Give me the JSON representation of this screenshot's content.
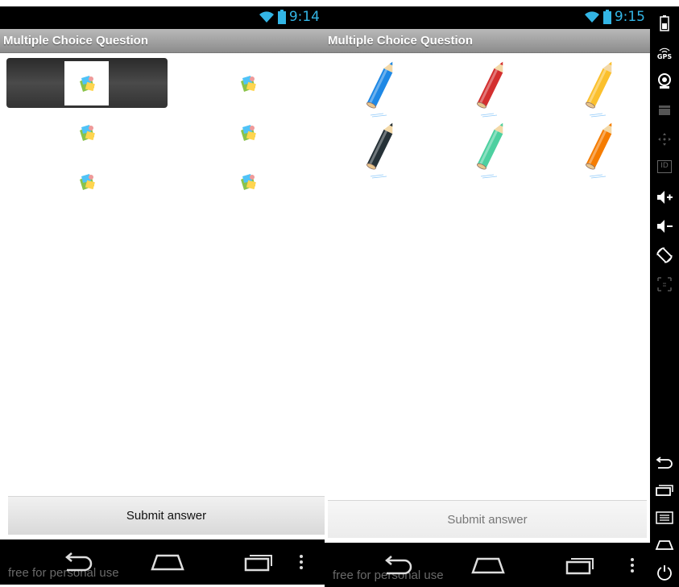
{
  "left_screen": {
    "status": {
      "time": "9:14"
    },
    "action_bar": {
      "title": "Multiple Choice Question"
    },
    "submit_label": "Submit answer",
    "watermark": "free for personal use"
  },
  "right_screen": {
    "status": {
      "time": "9:15"
    },
    "action_bar": {
      "title": "Multiple Choice Question"
    },
    "pencils": [
      {
        "color": "#1e88e5",
        "name": "blue-pencil-icon"
      },
      {
        "color": "#d32f2f",
        "name": "red-pencil-icon"
      },
      {
        "color": "#fbc02d",
        "name": "yellow-pencil-icon"
      },
      {
        "color": "#263238",
        "name": "black-pencil-icon"
      },
      {
        "color": "#4dd0a0",
        "name": "green-pencil-icon"
      },
      {
        "color": "#f57c00",
        "name": "orange-pencil-icon"
      }
    ],
    "submit_label": "Submit answer",
    "watermark": "free for personal use"
  },
  "sidebar": {
    "gps_label": "GPS",
    "id_label": "ID"
  },
  "colors": {
    "accent": "#33b5e5"
  }
}
